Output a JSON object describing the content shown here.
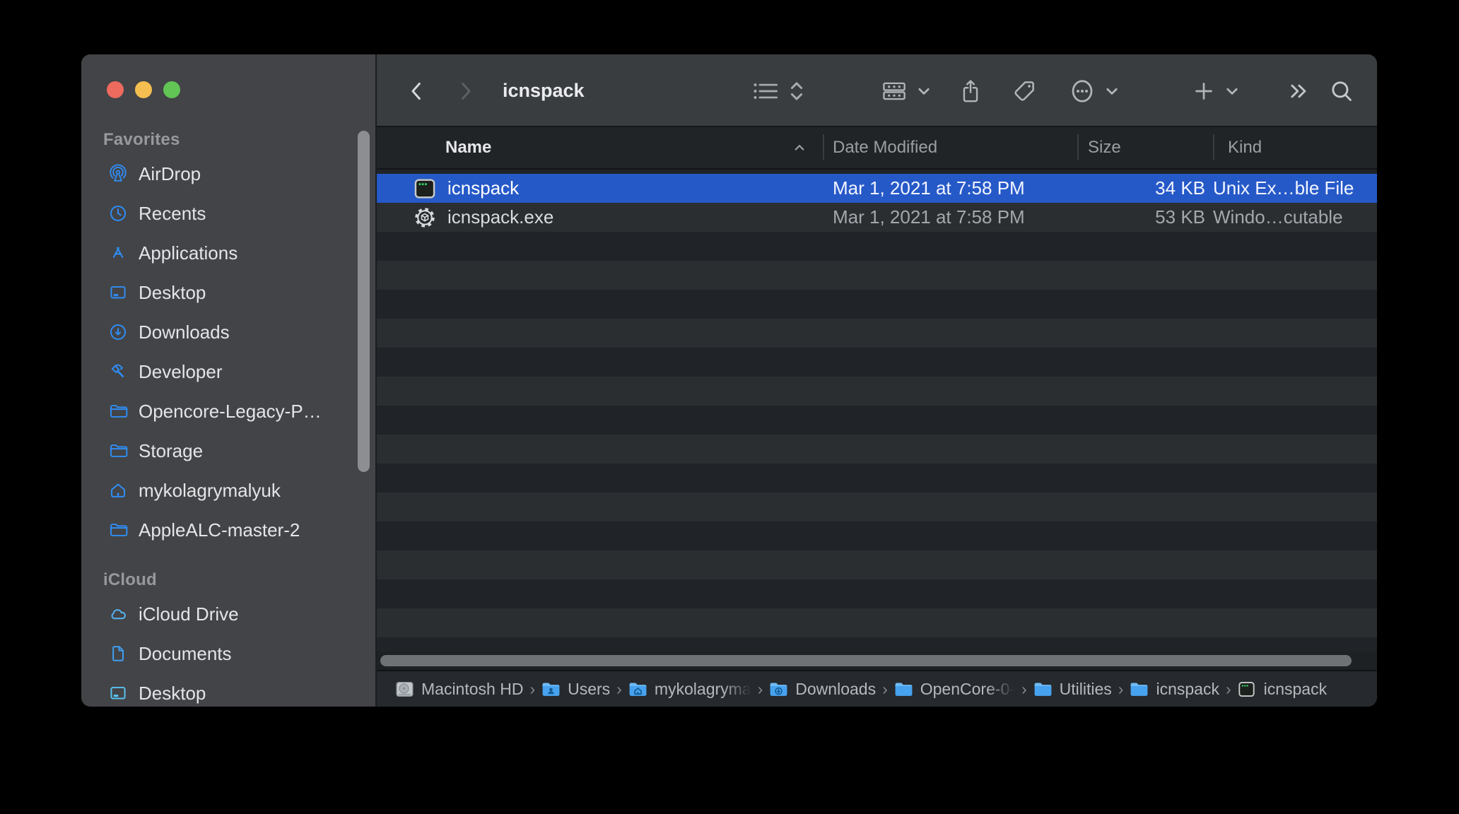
{
  "window": {
    "title": "icnspack"
  },
  "toolbar": {
    "title": "icnspack",
    "back": "chevron-left",
    "forward": "chevron-right",
    "view_control": "list-view",
    "icons": [
      "group-view",
      "share",
      "tag",
      "more-options",
      "add",
      "overflow",
      "search"
    ]
  },
  "sidebar": {
    "sections": [
      {
        "label": "Favorites",
        "items": [
          {
            "icon": "airdrop",
            "label": "AirDrop"
          },
          {
            "icon": "clock",
            "label": "Recents"
          },
          {
            "icon": "app-store",
            "label": "Applications"
          },
          {
            "icon": "desktop",
            "label": "Desktop"
          },
          {
            "icon": "download-circle",
            "label": "Downloads"
          },
          {
            "icon": "hammer",
            "label": "Developer"
          },
          {
            "icon": "folder",
            "label": "Opencore-Legacy-P…"
          },
          {
            "icon": "folder",
            "label": "Storage"
          },
          {
            "icon": "home",
            "label": "mykolagrymalyuk"
          },
          {
            "icon": "folder",
            "label": "AppleALC-master-2"
          }
        ]
      },
      {
        "label": "iCloud",
        "items": [
          {
            "icon": "cloud",
            "label": "iCloud Drive"
          },
          {
            "icon": "document",
            "label": "Documents"
          },
          {
            "icon": "desktop",
            "label": "Desktop"
          }
        ]
      }
    ]
  },
  "columns": {
    "name": "Name",
    "date_modified": "Date Modified",
    "size": "Size",
    "kind": "Kind",
    "sort_column": "Name",
    "sort_direction": "ascending"
  },
  "files": [
    {
      "icon": "unix-executable",
      "name": "icnspack",
      "date_modified": "Mar 1, 2021 at 7:58 PM",
      "size": "34 KB",
      "kind": "Unix Ex…ble File",
      "selected": true
    },
    {
      "icon": "windows-executable-gear",
      "name": "icnspack.exe",
      "date_modified": "Mar 1, 2021 at 7:58 PM",
      "size": "53 KB",
      "kind": "Windo…cutable",
      "selected": false
    }
  ],
  "path_bar": [
    {
      "icon": "hard-drive",
      "label": "Macintosh HD",
      "truncated": false
    },
    {
      "icon": "folder-users",
      "label": "Users",
      "truncated": false
    },
    {
      "icon": "folder-home",
      "label": "mykolagryma",
      "truncated": true
    },
    {
      "icon": "folder-downloads",
      "label": "Downloads",
      "truncated": false
    },
    {
      "icon": "folder",
      "label": "OpenCore-0-",
      "truncated": true
    },
    {
      "icon": "folder",
      "label": "Utilities",
      "truncated": false
    },
    {
      "icon": "folder",
      "label": "icnspack",
      "truncated": false
    },
    {
      "icon": "unix-executable",
      "label": "icnspack",
      "truncated": false
    }
  ],
  "colors": {
    "selection_blue": "#2659c8",
    "sidebar_bg": "#434447",
    "toolbar_bg": "#3a3d40",
    "row_dark": "#202327",
    "row_light": "#2a2e31",
    "pathbar_bg": "#26292d",
    "accent_blue": "#2f8df5",
    "traffic_red": "#ec6a5e",
    "traffic_yellow": "#f4bf50",
    "traffic_green": "#61c455"
  }
}
